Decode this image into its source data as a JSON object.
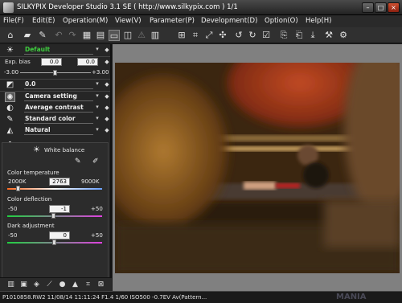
{
  "window": {
    "title": "SILKYPIX Developer Studio 3.1 SE ( http://www.silkypix.com )   1/1"
  },
  "menu": [
    "File(F)",
    "Edit(E)",
    "Operation(M)",
    "View(V)",
    "Parameter(P)",
    "Development(D)",
    "Option(O)",
    "Help(H)"
  ],
  "toolbar_icons": [
    "home-icon",
    "open-folder-icon",
    "eyedropper-icon",
    "undo-icon",
    "redo-icon",
    "grid-view-icon",
    "filmstrip-view-icon",
    "single-view-icon",
    "fullscreen-icon",
    "warning-icon",
    "compare-icon",
    "grid-overlay-icon",
    "crop-icon",
    "straighten-icon",
    "spot-icon",
    "rotate-left-icon",
    "rotate-right-icon",
    "check-icon",
    "copy-params-icon",
    "paste-params-icon",
    "develop-icon",
    "settings-icon"
  ],
  "panel": {
    "preset": "Default",
    "exposure": {
      "label": "Exp. bias",
      "value1": "0.0",
      "value2": "0.0",
      "min": "-3.00",
      "max": "+3.00",
      "level": 0.5
    },
    "tone_value": "0.0",
    "camera_setting": "Camera setting",
    "contrast": "Average contrast",
    "color": "Standard color",
    "natural": "Natural"
  },
  "white_balance": {
    "title": "White balance",
    "color_temperature": {
      "label": "Color temperature",
      "min": "2000K",
      "value": "2763",
      "max": "9000K",
      "level": 0.12
    },
    "color_deflection": {
      "label": "Color deflection",
      "min": "-50",
      "value": "-1",
      "max": "+50",
      "level": 0.49
    },
    "dark_adjustment": {
      "label": "Dark adjustment",
      "min": "-50",
      "value": "0",
      "max": "+50",
      "level": 0.5
    }
  },
  "status": {
    "text": "P1010858.RW2  11/08/14  11:11:24  F1.4  1/60  ISO500  -0.7EV  Av(Pattern..."
  },
  "watermark": "MANIA"
}
